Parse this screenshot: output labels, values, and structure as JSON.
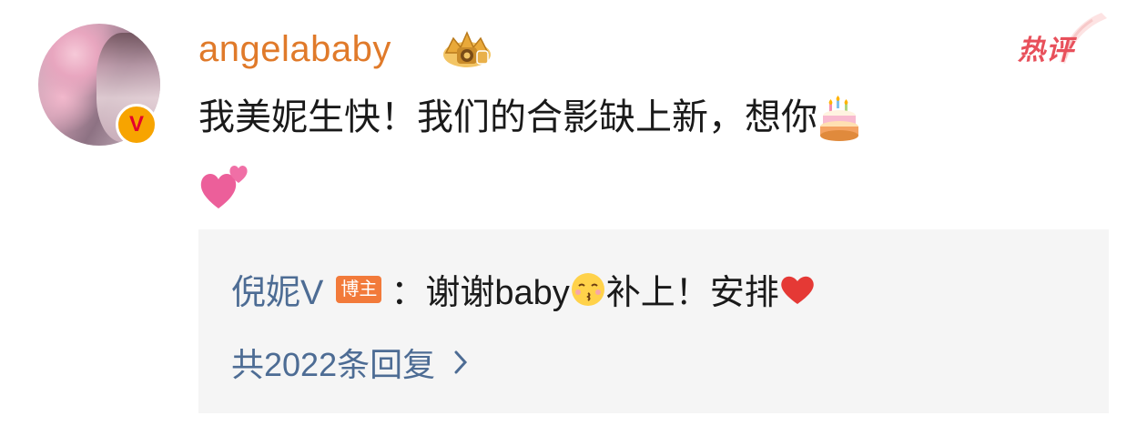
{
  "comment": {
    "username": "angelababy",
    "hot_label": "热评",
    "text": "我美妮生快！我们的合影缺上新，想你",
    "emojis": [
      "birthday-cake",
      "two-hearts"
    ]
  },
  "reply": {
    "author": "倪妮V",
    "host_badge": "博主",
    "separator": "：",
    "text_part1": "谢谢baby",
    "text_part2": "补上！安排",
    "emojis": [
      "kiss-face",
      "red-heart"
    ],
    "more_replies": "共2022条回复"
  },
  "colors": {
    "username": "#e07a2a",
    "link_blue": "#4d6c94",
    "hot_red": "#e8505b",
    "host_badge_bg": "#f27a3a",
    "reply_bg": "#f5f5f5"
  }
}
